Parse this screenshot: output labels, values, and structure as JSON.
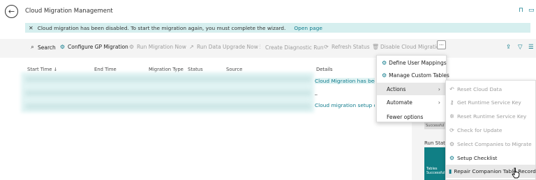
{
  "header": {
    "title": "Cloud Migration Management"
  },
  "banner": {
    "message": "Cloud migration has been disabled. To start the migration again, you must complete the wizard.",
    "link": "Open page"
  },
  "toolbar": {
    "search": "Search",
    "configure": "Configure GP Migration",
    "run_migration": "Run Migration Now",
    "run_upgrade": "Run Data Upgrade Now",
    "diagnostic": "Create Diagnostic Run",
    "refresh": "Refresh Status",
    "disable": "Disable Cloud Migration",
    "more": "···"
  },
  "grid": {
    "columns": [
      "Start Time ↓",
      "End Time",
      "Migration Type",
      "Status",
      "Source",
      "Details"
    ],
    "rows": [
      {
        "details": "Cloud Migration has been"
      },
      {
        "details": "_"
      },
      {
        "details": "Cloud migration setup com"
      }
    ]
  },
  "menu": {
    "items": [
      "Define User Mappings",
      "Manage Custom Tables",
      "Actions",
      "Automate",
      "Fewer options"
    ]
  },
  "submenu": {
    "items": [
      {
        "label": "Reset Cloud Data",
        "icon": "reset-icon",
        "enabled": false
      },
      {
        "label": "Get Runtime Service Key",
        "icon": "key-icon",
        "enabled": false
      },
      {
        "label": "Reset Runtime Service Key",
        "icon": "gear-icon",
        "enabled": false
      },
      {
        "label": "Check for Update",
        "icon": "refresh-icon",
        "enabled": false
      },
      {
        "label": "Select Companies to Migrate",
        "icon": "gear-icon",
        "enabled": false
      },
      {
        "label": "Setup Checklist",
        "icon": "gear-icon",
        "enabled": true
      },
      {
        "label": "Repair Companion Table Records",
        "icon": "database-icon",
        "enabled": true
      }
    ]
  },
  "side_panel": {
    "successful_label": "Successful",
    "run_status_label": "Run Statu",
    "tile_line1": "Tables",
    "tile_line2": "Successful"
  },
  "colors": {
    "accent": "#0f7b8c",
    "banner_bg": "#d6efef",
    "tile_bg": "#107f85"
  }
}
